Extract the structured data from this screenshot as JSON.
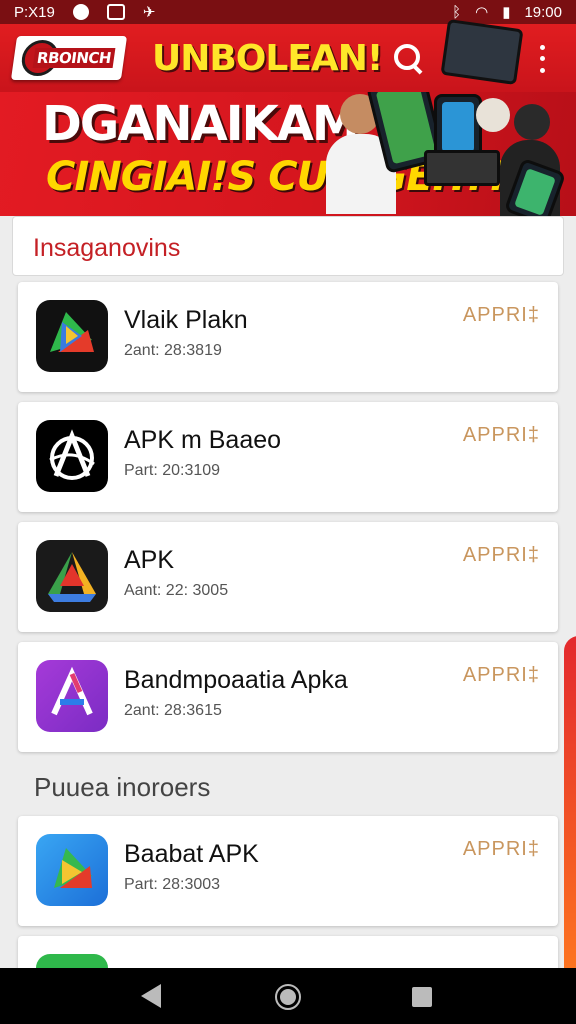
{
  "status_bar": {
    "time": "P:X19",
    "clock": "19:00"
  },
  "app_bar": {
    "logo_text": "RBOINCH",
    "title": "UNBOLEAN!"
  },
  "banner": {
    "headline": "DGANAIKAM",
    "subline": "CINGIAI!S CUINGEH??"
  },
  "section_title": "Insaganovins",
  "section2_title": "Puuea inoroers",
  "apps": [
    {
      "name": "Vlaik Plakn",
      "meta": "2ant: 28:3819",
      "action": "APPRI‡",
      "icon": "green-play-arrow-icon"
    },
    {
      "name": "APK m Baaeo",
      "meta": "Part: 20:3109",
      "action": "APPRI‡",
      "icon": "black-a-logo-icon"
    },
    {
      "name": "APK",
      "meta": "Aant: 22: 3005",
      "action": "APPRI‡",
      "icon": "triangle-drive-icon"
    },
    {
      "name": "Bandmpoaatia Apka",
      "meta": "2ant: 28:3615",
      "action": "APPRI‡",
      "icon": "purple-a-icon"
    },
    {
      "name": "Baabat APK",
      "meta": "Part: 28:3003",
      "action": "APPRI‡",
      "icon": "blue-play-icon"
    }
  ],
  "colors": {
    "primary": "#d9201e",
    "accent": "#ffe629",
    "action": "#c9965e"
  }
}
